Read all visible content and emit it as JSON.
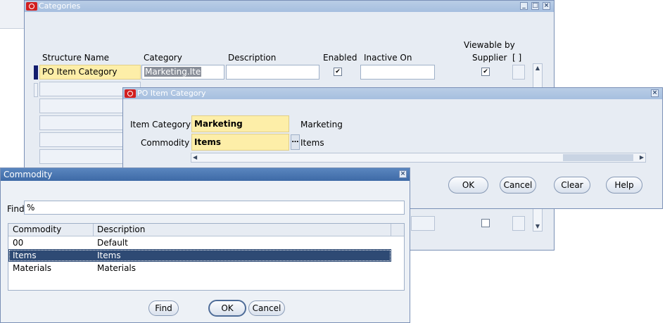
{
  "categories": {
    "title": "Categories",
    "headers": {
      "structure_name": "Structure Name",
      "category": "Category",
      "description": "Description",
      "enabled": "Enabled",
      "inactive_on": "Inactive On",
      "viewable_line1": "Viewable by",
      "viewable_line2": "Supplier",
      "bracket": "[ ]"
    },
    "row1": {
      "structure_name": "PO Item Category",
      "category": "Marketing.Ite",
      "description": "",
      "inactive_on": ""
    }
  },
  "po_item_category": {
    "title": "PO Item Category",
    "item_category_label": "Item Category",
    "item_category_value": "Marketing",
    "item_category_desc": "Marketing",
    "commodity_label": "Commodity",
    "commodity_value": "Items",
    "commodity_desc": "Items",
    "buttons": {
      "ok": "OK",
      "cancel": "Cancel",
      "clear": "Clear",
      "help": "Help"
    }
  },
  "commodity_lov": {
    "title": "Commodity",
    "find_label": "Find",
    "find_value": "%",
    "columns": [
      "Commodity",
      "Description"
    ],
    "rows": [
      {
        "commodity": "00",
        "description": "Default"
      },
      {
        "commodity": "Items",
        "description": "Items"
      },
      {
        "commodity": "Materials",
        "description": "Materials"
      }
    ],
    "buttons": {
      "find": "Find",
      "ok": "OK",
      "cancel": "Cancel"
    }
  },
  "colors": {
    "active_title": "#3e6aa6",
    "inactive_title": "#a6bfdf",
    "required_field": "#fdeea8",
    "selection": "#2e4a74"
  }
}
